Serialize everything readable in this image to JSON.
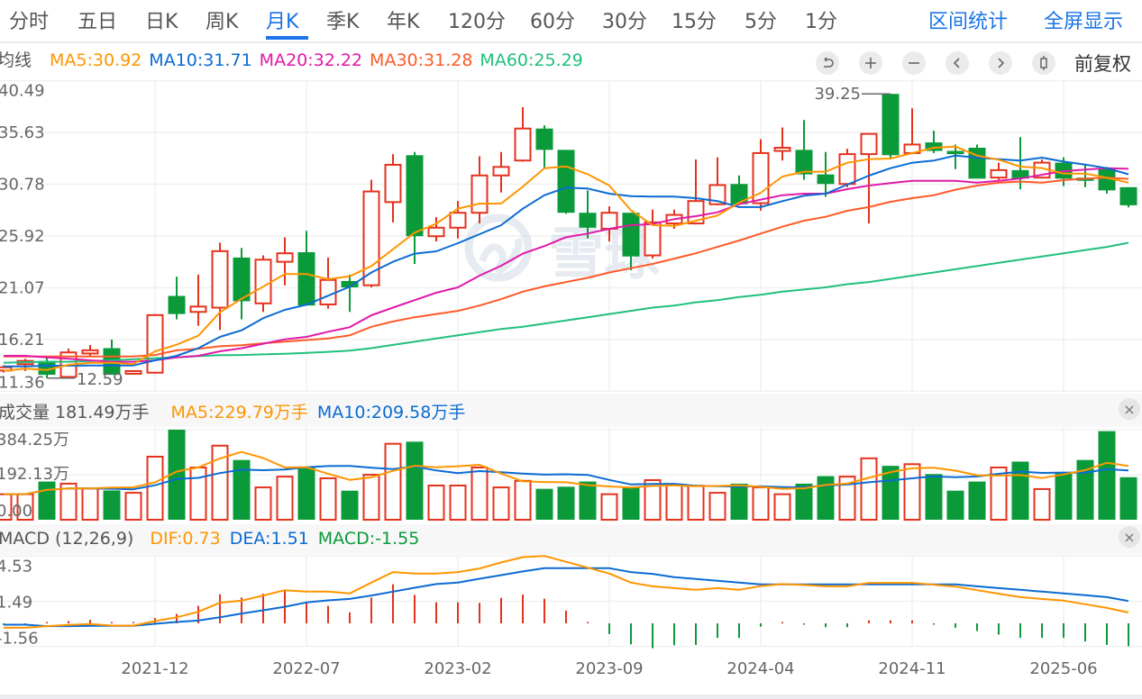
{
  "tabs": [
    {
      "label": "分时"
    },
    {
      "label": "五日"
    },
    {
      "label": "日K"
    },
    {
      "label": "周K"
    },
    {
      "label": "月K",
      "active": true
    },
    {
      "label": "季K"
    },
    {
      "label": "年K"
    },
    {
      "label": "120分"
    },
    {
      "label": "60分"
    },
    {
      "label": "30分"
    },
    {
      "label": "15分"
    },
    {
      "label": "5分"
    },
    {
      "label": "1分"
    }
  ],
  "tools": {
    "range_stats": "区间统计",
    "fullscreen": "全屏显示"
  },
  "legend": {
    "title": "均线",
    "ma5": "MA5:30.92",
    "ma10": "MA10:31.71",
    "ma20": "MA20:32.22",
    "ma30": "MA30:31.28",
    "ma60": "MA60:25.29"
  },
  "controls": {
    "icons": [
      "undo-icon",
      "zoom-in-icon",
      "zoom-out-icon",
      "chevron-left-icon",
      "chevron-right-icon",
      "candlestick-icon"
    ],
    "adjust": "前复权"
  },
  "volume_header": {
    "title": "成交量 181.49万手",
    "ma5": "MA5:229.79万手",
    "ma10": "MA10:209.58万手",
    "close": "×"
  },
  "macd_header": {
    "title": "MACD (12,26,9)",
    "dif": "DIF:0.73",
    "dea": "DEA:1.51",
    "macd": "MACD:-1.55",
    "close": "×"
  },
  "watermark": "雪球",
  "colors": {
    "up": "#e5321c",
    "down": "#0b9a3a",
    "ma5": "#ff9500",
    "ma10": "#0b6bd3",
    "ma20": "#e01aa9",
    "ma30": "#ff5a28",
    "ma60": "#20c07c",
    "accent": "#1a73e8"
  },
  "chart_data": {
    "type": "candlestick",
    "x": [
      "2021-05",
      "2021-06",
      "2021-07",
      "2021-08",
      "2021-09",
      "2021-10",
      "2021-11",
      "2021-12",
      "2022-01",
      "2022-02",
      "2022-03",
      "2022-04",
      "2022-05",
      "2022-06",
      "2022-07",
      "2022-08",
      "2022-09",
      "2022-10",
      "2022-11",
      "2022-12",
      "2023-01",
      "2023-02",
      "2023-03",
      "2023-04",
      "2023-05",
      "2023-06",
      "2023-07",
      "2023-08",
      "2023-09",
      "2023-10",
      "2023-11",
      "2023-12",
      "2024-01",
      "2024-02",
      "2024-03",
      "2024-04",
      "2024-05",
      "2024-06",
      "2024-07",
      "2024-08",
      "2024-09",
      "2024-10",
      "2024-11",
      "2024-12",
      "2025-01",
      "2025-02",
      "2025-03",
      "2025-04",
      "2025-05",
      "2025-06",
      "2025-07",
      "2025-08",
      "2025-09"
    ],
    "x_tick_labels": [
      "2021-12",
      "2022-07",
      "2023-02",
      "2023-09",
      "2024-04",
      "2024-11",
      "2025-06"
    ],
    "price_ticks": [
      "40.49",
      "35.63",
      "30.78",
      "25.92",
      "21.07",
      "16.21",
      "11.36"
    ],
    "price_range": [
      11.36,
      40.49
    ],
    "annotations": {
      "high": "39.25",
      "low": "12.59"
    },
    "ohlc": [
      [
        13.3,
        13.8,
        13.1,
        13.6
      ],
      [
        13.9,
        14.4,
        13.25,
        14.2
      ],
      [
        14.2,
        14.54,
        12.59,
        12.9
      ],
      [
        12.7,
        15.36,
        12.7,
        15.0
      ],
      [
        14.9,
        15.7,
        14.6,
        15.2
      ],
      [
        15.4,
        16.2,
        12.9,
        12.9
      ],
      [
        13.0,
        13.3,
        12.9,
        13.25
      ],
      [
        13.1,
        18.6,
        13.0,
        18.5
      ],
      [
        20.3,
        22.1,
        18.1,
        18.6
      ],
      [
        18.8,
        22.3,
        17.5,
        19.3
      ],
      [
        19.2,
        25.3,
        17.1,
        24.5
      ],
      [
        23.9,
        24.8,
        18.1,
        19.8
      ],
      [
        19.6,
        24.1,
        18.8,
        23.7
      ],
      [
        23.5,
        25.8,
        21.3,
        24.3
      ],
      [
        24.4,
        26.4,
        19.4,
        19.4
      ],
      [
        19.5,
        23.9,
        19.1,
        21.8
      ],
      [
        21.7,
        22.3,
        18.8,
        21.1
      ],
      [
        21.3,
        31.2,
        21.1,
        30.1
      ],
      [
        29.1,
        33.6,
        27.2,
        32.6
      ],
      [
        33.5,
        33.8,
        23.3,
        25.9
      ],
      [
        25.9,
        27.7,
        25.4,
        26.7
      ],
      [
        26.7,
        29.2,
        25.7,
        28.1
      ],
      [
        28.1,
        33.4,
        27.1,
        31.6
      ],
      [
        31.6,
        33.8,
        30.0,
        32.4
      ],
      [
        33.0,
        38.0,
        32.9,
        36.0
      ],
      [
        36.0,
        36.3,
        32.3,
        34.0
      ],
      [
        34.0,
        34.0,
        28.0,
        28.1
      ],
      [
        28.1,
        30.2,
        25.7,
        26.7
      ],
      [
        26.6,
        28.7,
        25.4,
        28.1
      ],
      [
        28.1,
        28.1,
        22.7,
        24.0
      ],
      [
        24.1,
        28.4,
        23.8,
        27.2
      ],
      [
        27.1,
        28.4,
        26.6,
        27.9
      ],
      [
        27.1,
        33.1,
        27.0,
        29.2
      ],
      [
        28.9,
        33.3,
        28.8,
        30.7
      ],
      [
        30.8,
        31.6,
        28.9,
        28.9
      ],
      [
        29.0,
        35.0,
        28.3,
        33.7
      ],
      [
        33.9,
        36.1,
        33.0,
        34.2
      ],
      [
        34.0,
        36.8,
        31.2,
        31.7
      ],
      [
        31.7,
        33.8,
        29.6,
        30.8
      ],
      [
        30.8,
        34.1,
        30.5,
        33.6
      ],
      [
        33.6,
        35.5,
        27.1,
        35.5
      ],
      [
        39.25,
        39.25,
        33.1,
        33.5
      ],
      [
        33.7,
        37.9,
        33.6,
        34.5
      ],
      [
        34.7,
        35.8,
        33.7,
        33.9
      ],
      [
        33.9,
        34.5,
        32.2,
        33.6
      ],
      [
        34.2,
        34.5,
        31.3,
        31.3
      ],
      [
        31.4,
        32.8,
        31.2,
        32.1
      ],
      [
        32.1,
        35.2,
        30.3,
        31.3
      ],
      [
        31.4,
        33.1,
        31.4,
        32.8
      ],
      [
        32.8,
        33.3,
        30.6,
        31.3
      ],
      [
        31.4,
        32.6,
        30.5,
        31.1
      ],
      [
        32.2,
        32.4,
        29.9,
        30.2
      ],
      [
        30.5,
        30.5,
        28.6,
        28.8
      ]
    ],
    "ma": {
      "ma5": [
        13.27,
        13.47,
        13.35,
        13.84,
        14.03,
        14.03,
        13.9,
        15.1,
        15.72,
        16.57,
        18.76,
        20.03,
        21.16,
        22.35,
        22.35,
        21.86,
        22.14,
        23.1,
        24.68,
        26.23,
        27.08,
        28.48,
        28.96,
        28.96,
        30.54,
        32.28,
        32.45,
        31.72,
        30.65,
        28.34,
        26.93,
        26.87,
        27.36,
        27.84,
        29.05,
        29.98,
        31.5,
        31.95,
        31.95,
        32.79,
        33.13,
        33.19,
        33.69,
        34.2,
        34.31,
        33.47,
        33.08,
        32.43,
        32.29,
        31.78,
        31.78,
        31.39,
        30.92
      ],
      "ma10": [
        13.69,
        13.69,
        13.75,
        13.75,
        13.78,
        13.78,
        13.78,
        14.26,
        14.68,
        15.39,
        16.46,
        17.07,
        18.21,
        18.99,
        19.47,
        20.32,
        21.16,
        22.5,
        23.5,
        24.26,
        24.48,
        25.24,
        26.09,
        26.93,
        28.48,
        29.75,
        30.46,
        30.37,
        29.89,
        29.66,
        29.61,
        29.61,
        29.47,
        29.2,
        28.63,
        28.63,
        29.19,
        29.7,
        29.89,
        30.74,
        31.58,
        32.28,
        32.79,
        32.99,
        33.47,
        33.27,
        33.13,
        32.99,
        33.27,
        32.9,
        32.62,
        32.28,
        31.71
      ],
      "ma20": [
        14.68,
        14.68,
        14.54,
        14.4,
        14.26,
        14.12,
        14.12,
        14.26,
        14.54,
        14.68,
        15.1,
        15.39,
        15.81,
        16.23,
        16.46,
        16.94,
        17.36,
        18.48,
        19.2,
        19.9,
        20.6,
        21.1,
        22.2,
        23.13,
        24.26,
        24.97,
        25.81,
        26.15,
        26.6,
        26.93,
        27.04,
        27.5,
        27.78,
        28.14,
        28.9,
        29.33,
        29.75,
        29.89,
        29.89,
        30.31,
        30.65,
        30.88,
        31.1,
        31.1,
        31.1,
        30.93,
        31.1,
        31.3,
        31.67,
        32.0,
        32.15,
        32.28,
        32.22
      ],
      "ma30": [
        14.62,
        14.62,
        14.62,
        14.62,
        14.62,
        14.62,
        14.62,
        14.76,
        15.2,
        15.34,
        15.58,
        15.68,
        15.86,
        16.01,
        16.16,
        16.3,
        16.6,
        17.4,
        17.9,
        18.3,
        18.6,
        18.9,
        19.4,
        20.0,
        20.7,
        21.2,
        21.6,
        22.0,
        22.5,
        22.9,
        23.3,
        23.8,
        24.3,
        24.9,
        25.5,
        26.15,
        26.79,
        27.36,
        27.72,
        28.29,
        28.63,
        29.13,
        29.47,
        29.75,
        30.26,
        30.65,
        30.93,
        31.02,
        30.93,
        31.16,
        31.3,
        31.39,
        31.28
      ],
      "ma60": [
        14.03,
        14.09,
        14.12,
        14.12,
        14.2,
        14.26,
        14.35,
        14.46,
        14.54,
        14.65,
        14.74,
        14.76,
        14.82,
        14.88,
        14.96,
        15.05,
        15.16,
        15.4,
        15.7,
        16.0,
        16.3,
        16.6,
        16.9,
        17.2,
        17.4,
        17.7,
        18.0,
        18.3,
        18.6,
        18.9,
        19.2,
        19.4,
        19.7,
        19.9,
        20.2,
        20.4,
        20.7,
        20.9,
        21.1,
        21.4,
        21.6,
        21.9,
        22.2,
        22.5,
        22.8,
        23.1,
        23.4,
        23.7,
        24.0,
        24.3,
        24.6,
        24.9,
        25.29
      ]
    },
    "volume_unit": "万手",
    "volume_ticks": [
      "384.25万",
      "192.13万",
      "0.00"
    ],
    "volume": [
      109,
      109,
      163,
      154,
      134,
      125,
      115,
      269,
      384.25,
      223,
      316,
      255,
      138,
      184,
      227,
      177,
      124,
      192,
      324,
      333,
      146,
      146,
      223,
      138,
      166,
      132,
      141,
      163,
      109,
      141,
      169,
      150,
      145,
      115,
      154,
      138,
      109,
      154,
      186,
      184,
      262,
      230,
      237,
      195,
      124,
      163,
      223,
      248,
      131,
      202,
      255,
      378,
      181.49
    ],
    "macd_ticks": [
      "4.53",
      "1.49",
      "-1.56"
    ],
    "dif": [
      -0.3,
      -0.3,
      -0.19,
      -0.11,
      -0.05,
      -0.15,
      -0.15,
      0.15,
      0.41,
      0.78,
      1.39,
      1.53,
      1.88,
      2.24,
      2.14,
      2.14,
      2.02,
      2.75,
      3.46,
      3.36,
      3.36,
      3.46,
      3.7,
      4.11,
      4.47,
      4.55,
      4.15,
      3.76,
      3.36,
      2.75,
      2.5,
      2.38,
      2.26,
      2.38,
      2.26,
      2.52,
      2.65,
      2.59,
      2.5,
      2.5,
      2.73,
      2.73,
      2.73,
      2.61,
      2.48,
      2.24,
      2.0,
      1.77,
      1.65,
      1.53,
      1.29,
      1.04,
      0.73
    ],
    "dea": [
      -0.09,
      -0.09,
      -0.19,
      -0.19,
      -0.17,
      -0.17,
      -0.17,
      -0.03,
      0.09,
      0.19,
      0.41,
      0.66,
      0.88,
      1.12,
      1.41,
      1.55,
      1.65,
      1.88,
      2.14,
      2.4,
      2.65,
      2.75,
      3.01,
      3.25,
      3.5,
      3.72,
      3.72,
      3.72,
      3.72,
      3.46,
      3.34,
      3.12,
      2.99,
      2.87,
      2.75,
      2.63,
      2.63,
      2.63,
      2.63,
      2.63,
      2.63,
      2.63,
      2.63,
      2.63,
      2.63,
      2.5,
      2.38,
      2.26,
      2.14,
      2.02,
      1.9,
      1.77,
      1.51
    ],
    "macd": [
      -0.1,
      -0.1,
      0.0,
      0.16,
      0.24,
      0.04,
      0.04,
      0.36,
      0.64,
      1.18,
      1.96,
      1.74,
      2.0,
      2.24,
      1.46,
      1.18,
      0.74,
      1.74,
      2.64,
      1.92,
      1.42,
      1.42,
      1.38,
      1.72,
      1.94,
      1.66,
      0.86,
      0.08,
      -0.72,
      -1.42,
      -1.68,
      -1.48,
      -1.46,
      -0.98,
      -0.98,
      -0.22,
      0.04,
      -0.08,
      -0.26,
      -0.26,
      0.2,
      0.2,
      0.2,
      -0.04,
      -0.3,
      -0.52,
      -0.76,
      -0.98,
      -0.98,
      -0.98,
      -1.22,
      -1.46,
      -1.55
    ]
  }
}
